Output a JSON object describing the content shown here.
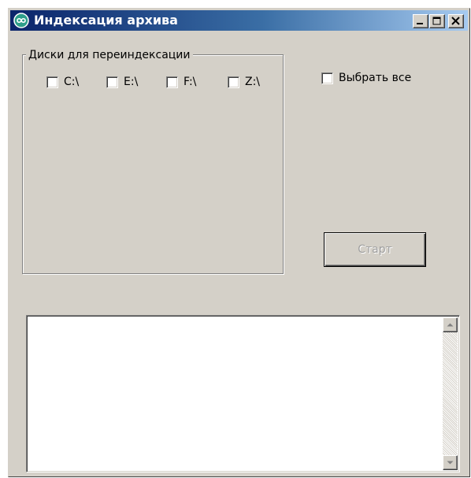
{
  "window": {
    "title": "Индексация архива",
    "app_icon": "infinity-app-icon",
    "controls": {
      "minimize_icon": "minimize-icon",
      "maximize_icon": "maximize-icon",
      "close_icon": "close-icon"
    },
    "colors": {
      "title_gradient_start": "#0a246a",
      "title_gradient_end": "#a6caf0",
      "face": "#d4d0c8"
    }
  },
  "drives_group": {
    "label": "Диски для переиндексации",
    "drives": [
      {
        "label": "C:\\",
        "checked": false
      },
      {
        "label": "E:\\",
        "checked": false
      },
      {
        "label": "F:\\",
        "checked": false
      },
      {
        "label": "Z:\\",
        "checked": false
      }
    ]
  },
  "select_all": {
    "label": "Выбрать все",
    "checked": false
  },
  "start_button": {
    "label": "Старт",
    "enabled": false
  },
  "log": {
    "text": "",
    "scroll_up_icon": "scroll-up-arrow-icon",
    "scroll_down_icon": "scroll-down-arrow-icon"
  }
}
